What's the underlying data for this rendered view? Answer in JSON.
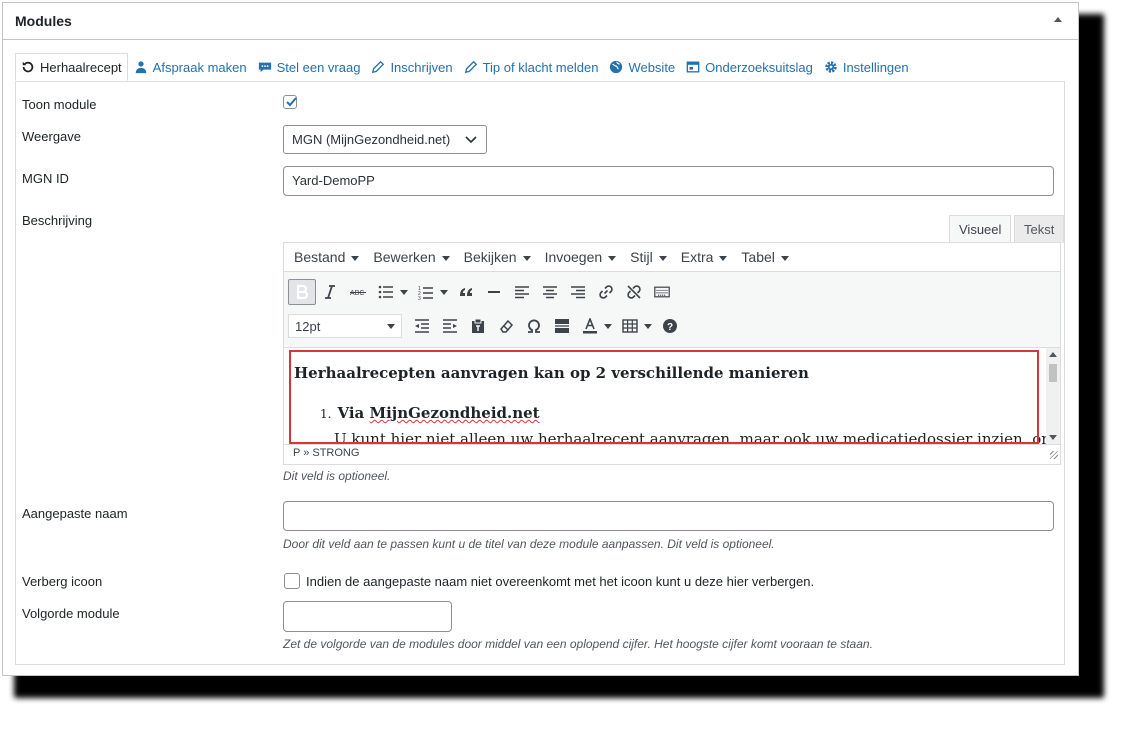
{
  "panel": {
    "title": "Modules"
  },
  "tabs": [
    {
      "label": "Herhaalrecept",
      "icon": "refresh-icon"
    },
    {
      "label": "Afspraak maken",
      "icon": "user-icon"
    },
    {
      "label": "Stel een vraag",
      "icon": "chat-bubble-icon"
    },
    {
      "label": "Inschrijven",
      "icon": "pencil-icon"
    },
    {
      "label": "Tip of klacht melden",
      "icon": "pencil-icon"
    },
    {
      "label": "Website",
      "icon": "globe-icon"
    },
    {
      "label": "Onderzoeksuitslag",
      "icon": "calendar-icon"
    },
    {
      "label": "Instellingen",
      "icon": "gear-icon"
    }
  ],
  "form": {
    "toon_module": {
      "label": "Toon module",
      "checked": true
    },
    "weergave": {
      "label": "Weergave",
      "value": "MGN (MijnGezondheid.net)"
    },
    "mgn_id": {
      "label": "MGN ID",
      "value": "Yard-DemoPP"
    },
    "beschrijving": {
      "label": "Beschrijving",
      "description": "Dit veld is optioneel."
    },
    "aangepaste_naam": {
      "label": "Aangepaste naam",
      "value": "",
      "description": "Door dit veld aan te passen kunt u de titel van deze module aanpassen. Dit veld is optioneel."
    },
    "verberg_icoon": {
      "label": "Verberg icoon",
      "checked": false,
      "text": "Indien de aangepaste naam niet overeenkomt met het icoon kunt u deze hier verbergen."
    },
    "volgorde_module": {
      "label": "Volgorde module",
      "value": "",
      "description": "Zet de volgorde van de modules door middel van een oplopend cijfer. Het hoogste cijfer komt vooraan te staan."
    }
  },
  "editor": {
    "tabs": {
      "visual": "Visueel",
      "text": "Tekst"
    },
    "menus": [
      "Bestand",
      "Bewerken",
      "Bekijken",
      "Invoegen",
      "Stijl",
      "Extra",
      "Tabel"
    ],
    "font_size": "12pt",
    "content": {
      "heading": "Herhaalrecepten aanvragen kan op 2 verschillende manieren",
      "list_number": "1.",
      "list_item_prefix": "Via ",
      "list_item_link": "MijnGezondheid.net",
      "paragraph": "U kunt hier niet alleen uw herhaalrecept aanvragen, maar ook uw medicatiedossier inzien, online"
    },
    "status_path": "P » STRONG"
  },
  "colors": {
    "link": "#2271b1",
    "highlight_box": "#d63638"
  }
}
